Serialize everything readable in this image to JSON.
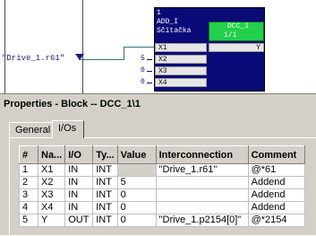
{
  "diagram": {
    "signal_label": "\"Drive_1.r61\"",
    "add_block": {
      "number": "1",
      "type": "ADD_I",
      "name": "Sčítačka",
      "inputs": [
        {
          "pin": "X1",
          "value": ""
        },
        {
          "pin": "X2",
          "value": "5"
        },
        {
          "pin": "X3",
          "value": "0"
        },
        {
          "pin": "X4",
          "value": "0"
        }
      ],
      "output": "Y"
    },
    "dcc_block": {
      "name": "DCC_1",
      "sub": "1/1"
    }
  },
  "window": {
    "title": "Properties - Block -- DCC_1\\1",
    "tabs": [
      {
        "label": "General",
        "active": false
      },
      {
        "label": "I/Os",
        "active": true
      }
    ]
  },
  "table": {
    "headers": [
      "#",
      "Na...",
      "I/O",
      "Ty...",
      "Value",
      "Interconnection",
      "Comment"
    ],
    "rows": [
      {
        "num": "1",
        "name": "X1",
        "io": "IN",
        "type": "INT",
        "value": "",
        "interconnection": "\"Drive_1.r61\"",
        "comment": "@*61"
      },
      {
        "num": "2",
        "name": "X2",
        "io": "IN",
        "type": "INT",
        "value": "5",
        "interconnection": "",
        "comment": "Addend"
      },
      {
        "num": "3",
        "name": "X3",
        "io": "IN",
        "type": "INT",
        "value": "0",
        "interconnection": "",
        "comment": "Addend"
      },
      {
        "num": "4",
        "name": "X4",
        "io": "IN",
        "type": "INT",
        "value": "0",
        "interconnection": "",
        "comment": "Addend"
      },
      {
        "num": "5",
        "name": "Y",
        "io": "OUT",
        "type": "INT",
        "value": "0",
        "interconnection": "\"Drive_1.p2154[0]\"",
        "comment": "@*2154"
      }
    ]
  },
  "colors": {
    "block_bg": "#0a0a78",
    "dcc_bg": "#22d04a",
    "wire": "#2a7a70"
  }
}
